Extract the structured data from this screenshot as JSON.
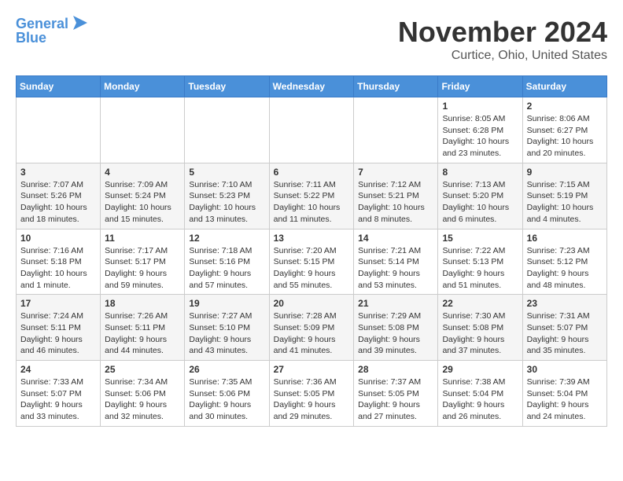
{
  "header": {
    "logo_line1": "General",
    "logo_line2": "Blue",
    "month": "November 2024",
    "location": "Curtice, Ohio, United States"
  },
  "weekdays": [
    "Sunday",
    "Monday",
    "Tuesday",
    "Wednesday",
    "Thursday",
    "Friday",
    "Saturday"
  ],
  "weeks": [
    [
      {
        "day": "",
        "info": ""
      },
      {
        "day": "",
        "info": ""
      },
      {
        "day": "",
        "info": ""
      },
      {
        "day": "",
        "info": ""
      },
      {
        "day": "",
        "info": ""
      },
      {
        "day": "1",
        "info": "Sunrise: 8:05 AM\nSunset: 6:28 PM\nDaylight: 10 hours\nand 23 minutes."
      },
      {
        "day": "2",
        "info": "Sunrise: 8:06 AM\nSunset: 6:27 PM\nDaylight: 10 hours\nand 20 minutes."
      }
    ],
    [
      {
        "day": "3",
        "info": "Sunrise: 7:07 AM\nSunset: 5:26 PM\nDaylight: 10 hours\nand 18 minutes."
      },
      {
        "day": "4",
        "info": "Sunrise: 7:09 AM\nSunset: 5:24 PM\nDaylight: 10 hours\nand 15 minutes."
      },
      {
        "day": "5",
        "info": "Sunrise: 7:10 AM\nSunset: 5:23 PM\nDaylight: 10 hours\nand 13 minutes."
      },
      {
        "day": "6",
        "info": "Sunrise: 7:11 AM\nSunset: 5:22 PM\nDaylight: 10 hours\nand 11 minutes."
      },
      {
        "day": "7",
        "info": "Sunrise: 7:12 AM\nSunset: 5:21 PM\nDaylight: 10 hours\nand 8 minutes."
      },
      {
        "day": "8",
        "info": "Sunrise: 7:13 AM\nSunset: 5:20 PM\nDaylight: 10 hours\nand 6 minutes."
      },
      {
        "day": "9",
        "info": "Sunrise: 7:15 AM\nSunset: 5:19 PM\nDaylight: 10 hours\nand 4 minutes."
      }
    ],
    [
      {
        "day": "10",
        "info": "Sunrise: 7:16 AM\nSunset: 5:18 PM\nDaylight: 10 hours\nand 1 minute."
      },
      {
        "day": "11",
        "info": "Sunrise: 7:17 AM\nSunset: 5:17 PM\nDaylight: 9 hours\nand 59 minutes."
      },
      {
        "day": "12",
        "info": "Sunrise: 7:18 AM\nSunset: 5:16 PM\nDaylight: 9 hours\nand 57 minutes."
      },
      {
        "day": "13",
        "info": "Sunrise: 7:20 AM\nSunset: 5:15 PM\nDaylight: 9 hours\nand 55 minutes."
      },
      {
        "day": "14",
        "info": "Sunrise: 7:21 AM\nSunset: 5:14 PM\nDaylight: 9 hours\nand 53 minutes."
      },
      {
        "day": "15",
        "info": "Sunrise: 7:22 AM\nSunset: 5:13 PM\nDaylight: 9 hours\nand 51 minutes."
      },
      {
        "day": "16",
        "info": "Sunrise: 7:23 AM\nSunset: 5:12 PM\nDaylight: 9 hours\nand 48 minutes."
      }
    ],
    [
      {
        "day": "17",
        "info": "Sunrise: 7:24 AM\nSunset: 5:11 PM\nDaylight: 9 hours\nand 46 minutes."
      },
      {
        "day": "18",
        "info": "Sunrise: 7:26 AM\nSunset: 5:11 PM\nDaylight: 9 hours\nand 44 minutes."
      },
      {
        "day": "19",
        "info": "Sunrise: 7:27 AM\nSunset: 5:10 PM\nDaylight: 9 hours\nand 43 minutes."
      },
      {
        "day": "20",
        "info": "Sunrise: 7:28 AM\nSunset: 5:09 PM\nDaylight: 9 hours\nand 41 minutes."
      },
      {
        "day": "21",
        "info": "Sunrise: 7:29 AM\nSunset: 5:08 PM\nDaylight: 9 hours\nand 39 minutes."
      },
      {
        "day": "22",
        "info": "Sunrise: 7:30 AM\nSunset: 5:08 PM\nDaylight: 9 hours\nand 37 minutes."
      },
      {
        "day": "23",
        "info": "Sunrise: 7:31 AM\nSunset: 5:07 PM\nDaylight: 9 hours\nand 35 minutes."
      }
    ],
    [
      {
        "day": "24",
        "info": "Sunrise: 7:33 AM\nSunset: 5:07 PM\nDaylight: 9 hours\nand 33 minutes."
      },
      {
        "day": "25",
        "info": "Sunrise: 7:34 AM\nSunset: 5:06 PM\nDaylight: 9 hours\nand 32 minutes."
      },
      {
        "day": "26",
        "info": "Sunrise: 7:35 AM\nSunset: 5:06 PM\nDaylight: 9 hours\nand 30 minutes."
      },
      {
        "day": "27",
        "info": "Sunrise: 7:36 AM\nSunset: 5:05 PM\nDaylight: 9 hours\nand 29 minutes."
      },
      {
        "day": "28",
        "info": "Sunrise: 7:37 AM\nSunset: 5:05 PM\nDaylight: 9 hours\nand 27 minutes."
      },
      {
        "day": "29",
        "info": "Sunrise: 7:38 AM\nSunset: 5:04 PM\nDaylight: 9 hours\nand 26 minutes."
      },
      {
        "day": "30",
        "info": "Sunrise: 7:39 AM\nSunset: 5:04 PM\nDaylight: 9 hours\nand 24 minutes."
      }
    ]
  ]
}
